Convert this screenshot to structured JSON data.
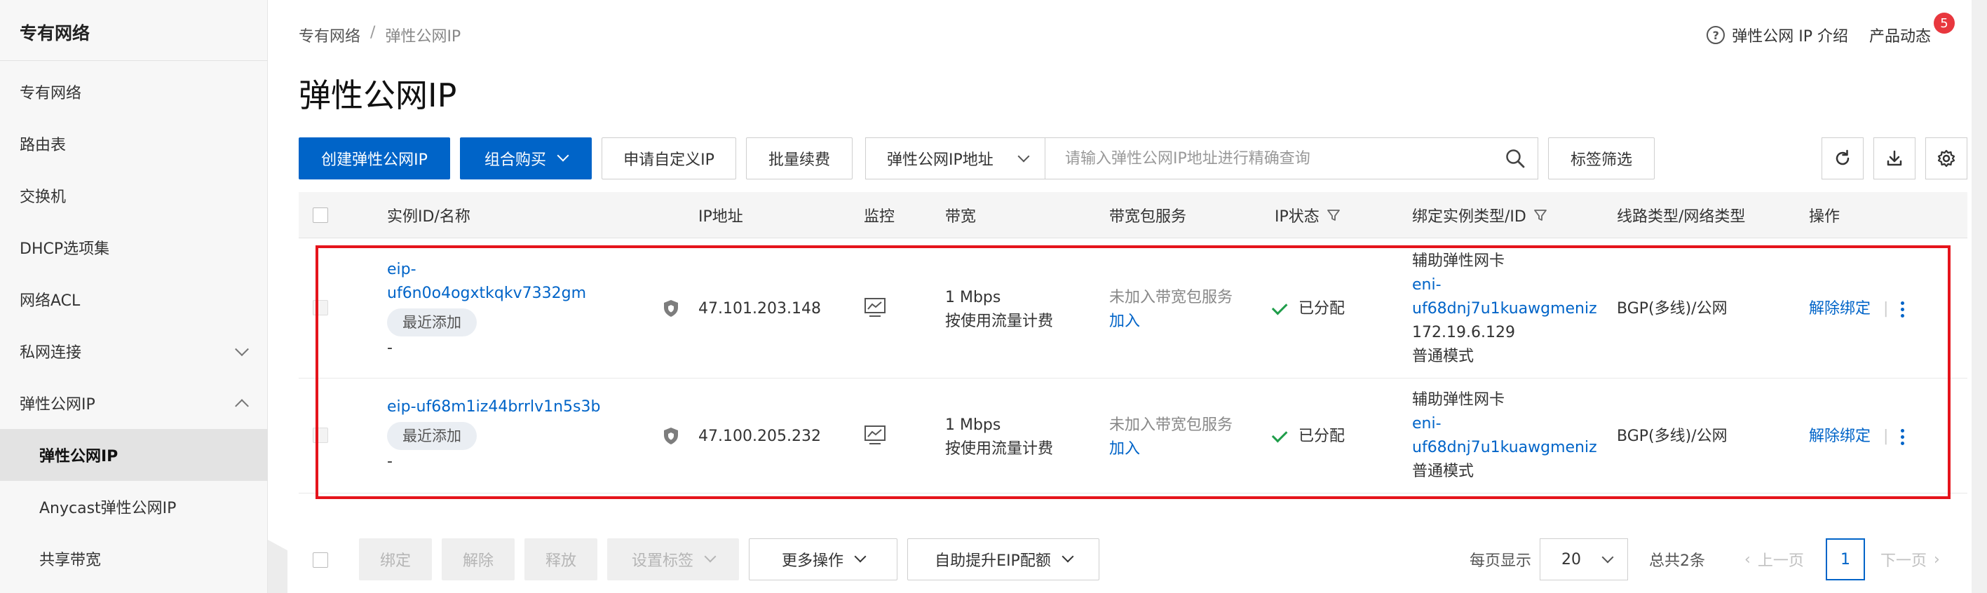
{
  "sidebar": {
    "title": "专有网络",
    "items": [
      {
        "label": "专有网络"
      },
      {
        "label": "路由表"
      },
      {
        "label": "交换机"
      },
      {
        "label": "DHCP选项集"
      },
      {
        "label": "网络ACL"
      },
      {
        "label": "私网连接"
      },
      {
        "label": "弹性公网IP"
      },
      {
        "label": "弹性公网IP"
      },
      {
        "label": "Anycast弹性公网IP"
      },
      {
        "label": "共享带宽"
      }
    ]
  },
  "header": {
    "breadcrumb": [
      "专有网络",
      "/",
      "弹性公网IP"
    ],
    "title": "弹性公网IP",
    "help_link": "弹性公网 IP 介绍",
    "news_label": "产品动态",
    "news_badge": "5"
  },
  "toolbar": {
    "create": "创建弹性公网IP",
    "combo_buy": "组合购买",
    "custom_ip": "申请自定义IP",
    "batch_renew": "批量续费",
    "search_field": "弹性公网IP地址",
    "search_placeholder": "请输入弹性公网IP地址进行精确查询",
    "tag_filter": "标签筛选"
  },
  "table": {
    "columns": [
      "实例ID/名称",
      "IP地址",
      "监控",
      "带宽",
      "带宽包服务",
      "IP状态",
      "绑定实例类型/ID",
      "线路类型/网络类型",
      "操作"
    ],
    "rows": [
      {
        "id_line1": "eip-",
        "id_line2": "uf6n0o4ogxtkqkv7332gm",
        "tag": "最近添加",
        "name": "-",
        "ip": "47.101.203.148",
        "bandwidth": "1 Mbps",
        "billing": "按使用流量计费",
        "pkg_status": "未加入带宽包服务",
        "pkg_action": "加入",
        "ip_status": "已分配",
        "bind_type": "辅助弹性网卡",
        "bind_id_line1": "eni-",
        "bind_id_line2": "uf68dnj7u1kuawgmeniz",
        "bind_ip": "172.19.6.129",
        "bind_mode": "普通模式",
        "line_type": "BGP(多线)/公网",
        "op": "解除绑定"
      },
      {
        "id_line1": "eip-uf68m1iz44brrlv1n5s3b",
        "tag": "最近添加",
        "name": "-",
        "ip": "47.100.205.232",
        "bandwidth": "1 Mbps",
        "billing": "按使用流量计费",
        "pkg_status": "未加入带宽包服务",
        "pkg_action": "加入",
        "ip_status": "已分配",
        "bind_type": "辅助弹性网卡",
        "bind_id_line1": "eni-",
        "bind_id_line2": "uf68dnj7u1kuawgmeniz",
        "bind_mode": "普通模式",
        "line_type": "BGP(多线)/公网",
        "op": "解除绑定"
      }
    ]
  },
  "footer": {
    "bind": "绑定",
    "unbind": "解除",
    "release": "释放",
    "set_tag": "设置标签",
    "more_ops": "更多操作",
    "auto_quota": "自助提升EIP配额",
    "per_page_label": "每页显示",
    "per_page_value": "20",
    "total": "总共2条",
    "prev": "上一页",
    "page": "1",
    "next": "下一页"
  },
  "colors": {
    "primary": "#0064c8",
    "highlight": "#e5141c",
    "status_ok": "#1f9d4a",
    "badge": "#e8373e"
  }
}
